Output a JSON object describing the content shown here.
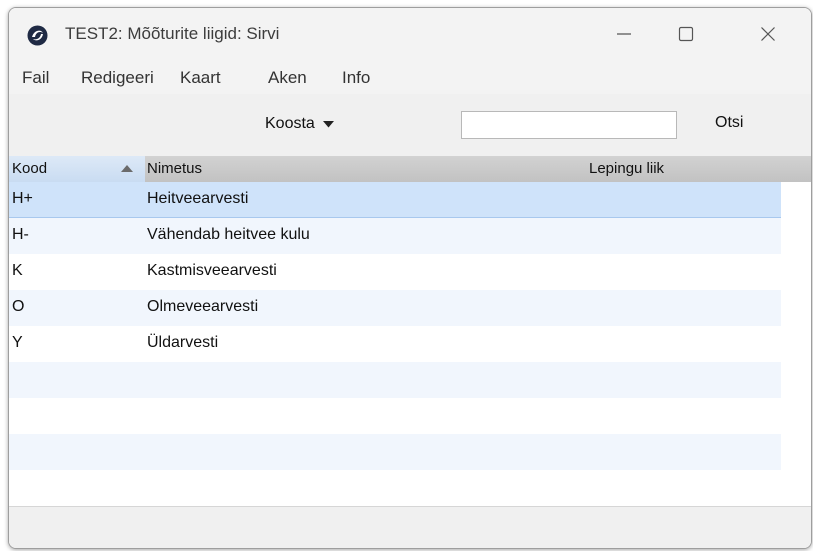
{
  "window": {
    "title": "TEST2: Mõõturite liigid: Sirvi"
  },
  "menu": {
    "items": [
      {
        "label": "Fail"
      },
      {
        "label": "Redigeeri"
      },
      {
        "label": "Kaart"
      },
      {
        "label": "Aken"
      },
      {
        "label": "Info"
      }
    ]
  },
  "toolbar": {
    "compose_label": "Koosta",
    "search_value": "",
    "search_button": "Otsi"
  },
  "table": {
    "columns": [
      "Kood",
      "Nimetus",
      "Lepingu liik"
    ],
    "sort_column": "Kood",
    "sort_direction": "ascending",
    "rows": [
      {
        "kood": "H+",
        "nimetus": "Heitveearvesti",
        "lepingu_liik": ""
      },
      {
        "kood": "H-",
        "nimetus": "Vähendab heitvee kulu",
        "lepingu_liik": ""
      },
      {
        "kood": "K",
        "nimetus": "Kastmisveearvesti",
        "lepingu_liik": ""
      },
      {
        "kood": "O",
        "nimetus": "Olmeveearvesti",
        "lepingu_liik": ""
      },
      {
        "kood": "Y",
        "nimetus": "Üldarvesti",
        "lepingu_liik": ""
      }
    ],
    "selected_row": 0
  },
  "icons": {
    "app": "app-logo-icon",
    "minimize": "minimize-icon",
    "maximize": "maximize-icon",
    "close": "close-icon",
    "dropdown": "caret-down-icon",
    "sort": "sort-ascending-icon"
  },
  "colors": {
    "selection": "#cfe3fa",
    "alt_row": "#f1f6fd",
    "header": "#c8c8c8",
    "sorted_header": "#d3e3f5"
  }
}
